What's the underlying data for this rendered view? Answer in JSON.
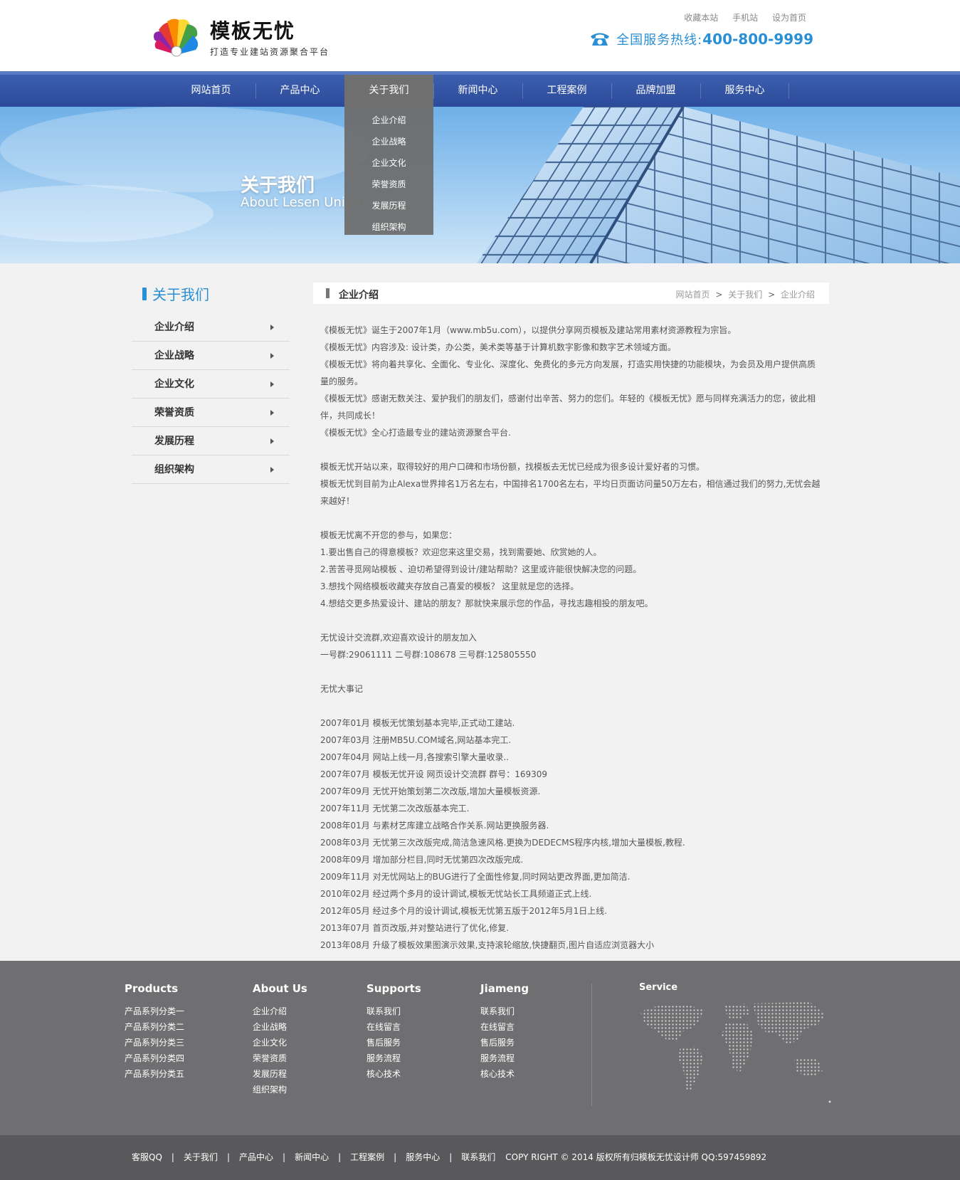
{
  "header": {
    "logo_title": "模板无忧",
    "logo_subtitle": "打造专业建站资源聚合平台",
    "top_links": [
      "收藏本站",
      "手机站",
      "设为首页"
    ],
    "hotline_label": "全国服务热线:",
    "hotline_number": "400-800-9999"
  },
  "nav": {
    "items": [
      "网站首页",
      "产品中心",
      "关于我们",
      "新闻中心",
      "工程案例",
      "品牌加盟",
      "服务中心"
    ],
    "active": "关于我们",
    "dropdown": [
      "企业介绍",
      "企业战略",
      "企业文化",
      "荣誉资质",
      "发展历程",
      "组织架构"
    ]
  },
  "banner": {
    "title": "关于我们",
    "subtitle": "About Lesen Union"
  },
  "sidebar": {
    "title": "关于我们",
    "items": [
      "企业介绍",
      "企业战略",
      "企业文化",
      "荣誉资质",
      "发展历程",
      "组织架构"
    ]
  },
  "content": {
    "title": "企业介绍",
    "breadcrumb": [
      "网站首页",
      "关于我们",
      "企业介绍"
    ],
    "breadcrumb_sep": ">",
    "paragraphs": [
      "《模板无忧》诞生于2007年1月（www.mb5u.com），以提供分享网页模板及建站常用素材资源教程为宗旨。",
      "《模板无忧》内容涉及: 设计类，办公类，美术类等基于计算机数字影像和数字艺术领域方面。",
      "《模板无忧》将向着共享化、全面化、专业化、深度化、免费化的多元方向发展，打造实用快捷的功能模块，为会员及用户提供高质量的服务。",
      "《模板无忧》感谢无数关注、爱护我们的朋友们，感谢付出辛苦、努力的您们。年轻的《模板无忧》愿与同样充满活力的您，彼此相伴，共同成长！",
      "《模板无忧》全心打造最专业的建站资源聚合平台.",
      "",
      "模板无忧开站以来，取得较好的用户口碑和市场份额，找模板去无忧已经成为很多设计爱好者的习惯。",
      "模板无忧到目前为止Alexa世界排名1万名左右，中国排名1700名左右，平均日页面访问量50万左右，相信通过我们的努力,无忧会越来越好！",
      "",
      "模板无忧离不开您的参与，如果您：",
      "1.要出售自己的得意模板？欢迎您来这里交易，找到需要她、欣赏她的人。",
      "2.苦苦寻觅网站模板 、迫切希望得到设计/建站帮助？这里或许能很快解决您的问题。",
      "3.想找个网络模板收藏夹存放自己喜爱的模板？ 这里就是您的选择。",
      "4.想结交更多热爱设计、建站的朋友？那就快来展示您的作品，寻找志趣相投的朋友吧。",
      "",
      "无忧设计交流群,欢迎喜欢设计的朋友加入",
      "一号群:29061111 二号群:108678 三号群:125805550",
      "",
      "无忧大事记",
      "",
      "2007年01月 模板无忧策划基本完毕,正式动工建站.",
      "2007年03月 注册MB5U.COM域名,网站基本完工.",
      "2007年04月 网站上线一月,各搜索引擎大量收录..",
      "2007年07月 模板无忧开设 网页设计交流群 群号：169309",
      "2007年09月 无忧开始策划第二次改版,增加大量模板资源.",
      "2007年11月 无忧第二次改版基本完工.",
      "2008年01月 与素材艺库建立战略合作关系.网站更换服务器.",
      "2008年03月 无忧第三次改版完成,简洁急速风格.更换为DEDECMS程序内核,增加大量模板,教程.",
      "2008年09月 增加部分栏目,同时无忧第四次改版完成.",
      "2009年11月 对无忧网站上的BUG进行了全面性修复,同时网站更改界面,更加简洁.",
      "2010年02月 经过两个多月的设计调试,模板无忧站长工具频道正式上线.",
      "2012年05月 经过多个月的设计调试,模板无忧第五版于2012年5月1日上线.",
      "2013年07月 首页改版,并对整站进行了优化,修复.",
      "2013年08月 升级了模板效果图演示效果,支持滚轮缩放,快捷翻页,图片自适应浏览器大小"
    ]
  },
  "footer": {
    "columns": [
      {
        "title": "Products",
        "items": [
          "产品系列分类一",
          "产品系列分类二",
          "产品系列分类三",
          "产品系列分类四",
          "产品系列分类五"
        ]
      },
      {
        "title": "About Us",
        "items": [
          "企业介绍",
          "企业战略",
          "企业文化",
          "荣誉资质",
          "发展历程",
          "组织架构"
        ]
      },
      {
        "title": "Supports",
        "items": [
          "联系我们",
          "在线留言",
          "售后服务",
          "服务流程",
          "核心技术"
        ]
      },
      {
        "title": "Jiameng",
        "items": [
          "联系我们",
          "在线留言",
          "售后服务",
          "服务流程",
          "核心技术"
        ]
      }
    ],
    "service_title": "Service",
    "bottom_links": [
      "客服QQ",
      "关于我们",
      "产品中心",
      "新闻中心",
      "工程案例",
      "服务中心",
      "联系我们"
    ],
    "copyright": "COPY RIGHT © 2014 版权所有归模板无忧设计师 QQ:597459892"
  },
  "colors": {
    "accent": "#2a8fd4",
    "nav": "#2d4a9a",
    "footer": "#6f6f71",
    "bottom_bar": "#59595b"
  }
}
